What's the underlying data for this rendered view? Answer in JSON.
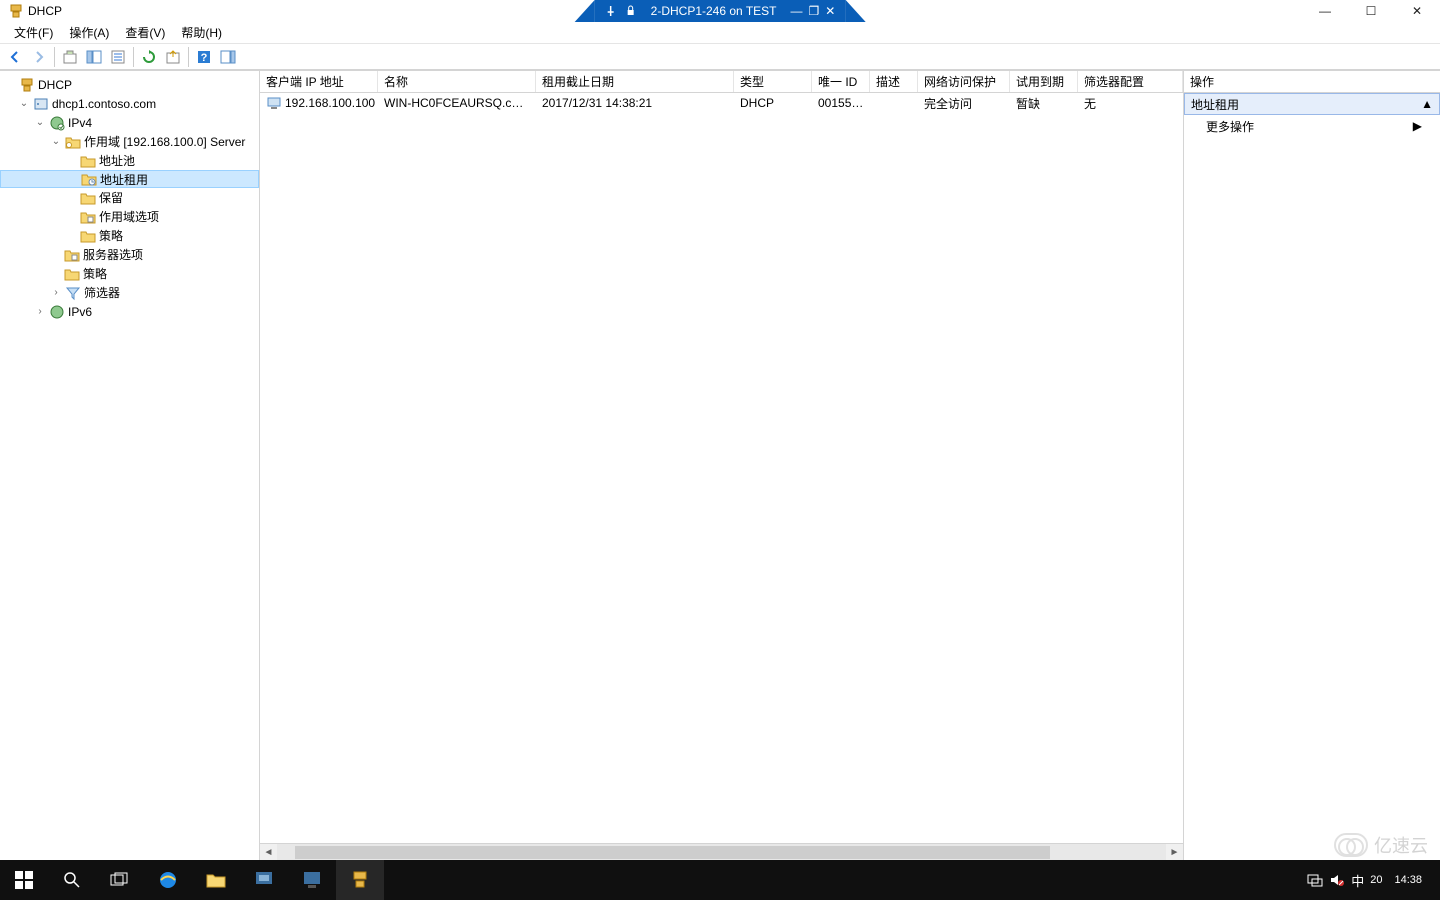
{
  "window": {
    "title": "DHCP",
    "remote_session_title": "2-DHCP1-246 on TEST"
  },
  "menu": {
    "file": "文件(F)",
    "action": "操作(A)",
    "view": "查看(V)",
    "help": "帮助(H)"
  },
  "tree": {
    "root": "DHCP",
    "server": "dhcp1.contoso.com",
    "ipv4": "IPv4",
    "scope": "作用域 [192.168.100.0] Server",
    "pool": "地址池",
    "leases": "地址租用",
    "reservations": "保留",
    "scope_options": "作用域选项",
    "policies_scope": "策略",
    "server_options": "服务器选项",
    "policies_server": "策略",
    "filters": "筛选器",
    "ipv6": "IPv6"
  },
  "columns": {
    "client_ip": "客户端 IP 地址",
    "name": "名称",
    "lease_expiration": "租用截止日期",
    "type": "类型",
    "unique_id": "唯一 ID",
    "description": "描述",
    "nap": "网络访问保护",
    "probation": "试用到期",
    "filter": "筛选器配置"
  },
  "rows": [
    {
      "client_ip": "192.168.100.100",
      "name": "WIN-HC0FCEAURSQ.con...",
      "lease_expiration": "2017/12/31 14:38:21",
      "type": "DHCP",
      "unique_id": "00155d...",
      "description": "",
      "nap": "完全访问",
      "probation": "暂缺",
      "filter": "无"
    }
  ],
  "actions_pane": {
    "header": "操作",
    "section_title": "地址租用",
    "more_actions": "更多操作"
  },
  "taskbar": {
    "clock_time": "14:38",
    "clock_extra": "20",
    "ime": "中"
  },
  "watermark": "亿速云"
}
